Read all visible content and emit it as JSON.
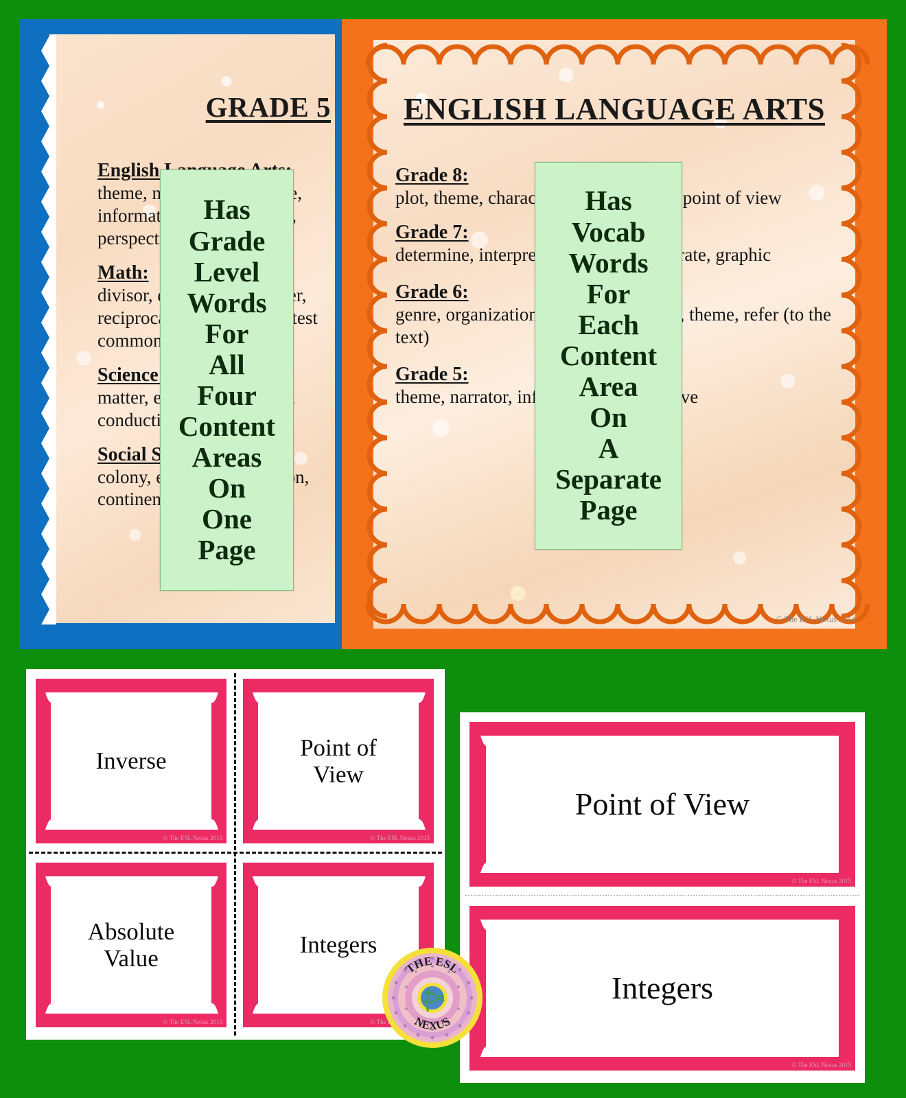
{
  "colors": {
    "background_green": "#0d8f0d",
    "left_poster_border": "#0f6fc0",
    "right_poster_border": "#f4721b",
    "callout_green": "#ccf2c9",
    "card_pink": "#ec2a63"
  },
  "posters": {
    "left": {
      "title": "GRADE 5",
      "sections": [
        {
          "heading": "English Language Arts:",
          "body": "theme, narrator, persuasive, information, point of view, perspective"
        },
        {
          "heading": "Math:",
          "body": "divisor, quotient, remainder, reciprocal, operation, greatest common factor"
        },
        {
          "heading": "Science:",
          "body": "matter, energy, hypothesis, conduction, circuit, other"
        },
        {
          "heading": "Social Studies:",
          "body": "colony, explorer, navigation, continent, country"
        }
      ],
      "callout_lines": [
        "Has",
        "Grade",
        "Level",
        "Words",
        "For",
        "All",
        "Four",
        "Content",
        "Areas",
        "On",
        "One",
        "Page"
      ]
    },
    "right": {
      "title": "ENGLISH LANGUAGE ARTS",
      "sections": [
        {
          "heading": "Grade 8:",
          "body": "plot, theme, characterization, narrator, point of view"
        },
        {
          "heading": "Grade 7:",
          "body": "determine, interpret, summarize, illustrate, graphic"
        },
        {
          "heading": "Grade 6:",
          "body": "genre, organization, strategy, evidence, theme, refer (to the text)"
        },
        {
          "heading": "Grade 5:",
          "body": "theme, narrator, information, perspective"
        }
      ],
      "callout_lines": [
        "Has",
        "Vocab",
        "Words",
        "For",
        "Each",
        "Content",
        "Area",
        "On",
        "A",
        "Separate",
        "Page"
      ],
      "copyright": "© The ESL Nexus 2014"
    }
  },
  "cards": {
    "copyright": "© The ESL Nexus 2015",
    "small_grid": [
      {
        "label": "Inverse"
      },
      {
        "label": "Point of\nView"
      },
      {
        "label": "Absolute\nValue"
      },
      {
        "label": "Integers"
      }
    ],
    "large": [
      {
        "label": "Point of View"
      },
      {
        "label": "Integers"
      }
    ]
  },
  "logo": {
    "name": "the-esl-nexus-logo",
    "text_top": "THE ESL",
    "text_bottom": "NEXUS",
    "center_icon": "globe-icon"
  }
}
